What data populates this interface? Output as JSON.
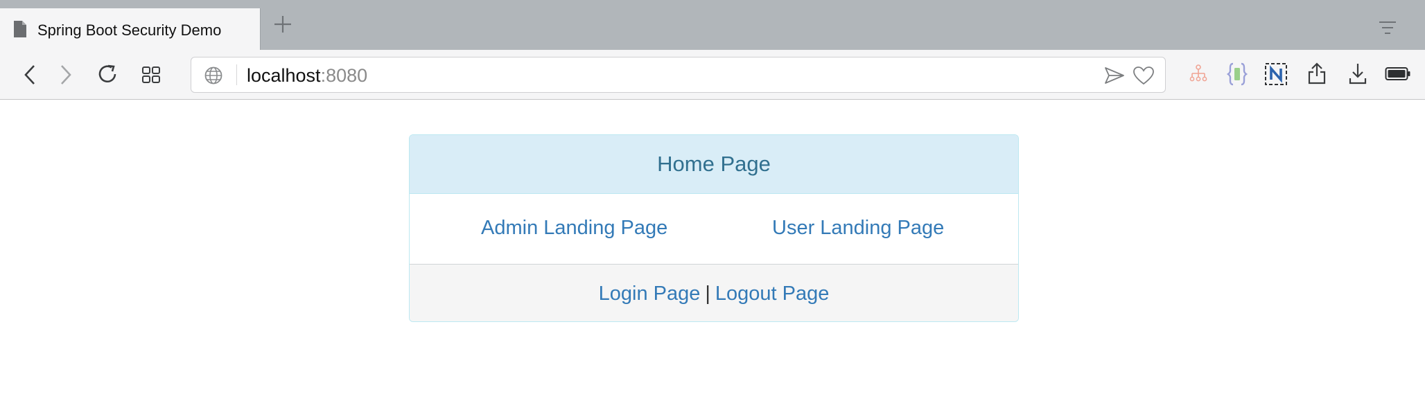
{
  "browser": {
    "tab_title": "Spring Boot Security Demo",
    "url_host": "localhost",
    "url_port": ":8080",
    "icons": [
      "document-icon",
      "plus-icon",
      "tab-overview-icon",
      "back-icon",
      "forward-icon",
      "reload-icon",
      "grid-icon",
      "globe-icon",
      "send-icon",
      "heart-icon",
      "sitemap-extension-icon",
      "json-extension-icon",
      "n-extension-icon",
      "share-icon",
      "download-icon",
      "battery-icon"
    ]
  },
  "panel": {
    "heading": "Home Page",
    "admin_link": "Admin Landing Page",
    "user_link": "User Landing Page",
    "login_link": "Login Page",
    "separator": "|",
    "logout_link": "Logout Page"
  },
  "colors": {
    "heading_bg": "#d9edf7",
    "border": "#bce8f1",
    "link": "#337ab7",
    "heading_text": "#31708f"
  }
}
